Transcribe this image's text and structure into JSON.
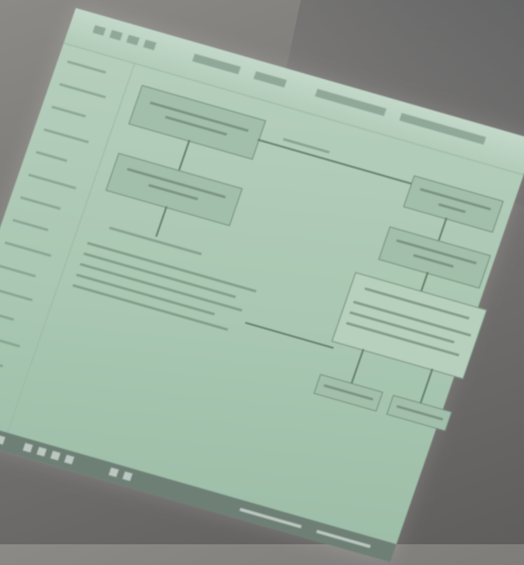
{
  "scene": {
    "subject": "photo-of-projected-flowchart",
    "colors": {
      "wall": "#7c7a77",
      "screen": "#a9c7b2",
      "box_fill": "#a2bfab",
      "box_stroke": "#6f8877",
      "taskbar": "#6e7f76"
    }
  }
}
